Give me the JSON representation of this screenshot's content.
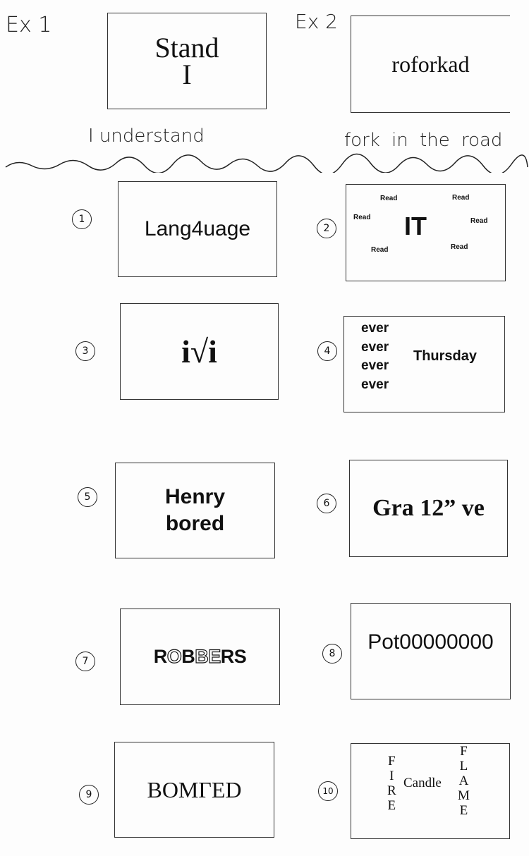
{
  "examples": [
    {
      "label": "Ex 1",
      "puzzle": [
        "Stand",
        "I"
      ],
      "answer": "I understand"
    },
    {
      "label": "Ex 2",
      "puzzle": [
        "roforkad"
      ],
      "answer": "fork in the road"
    }
  ],
  "puzzles": [
    {
      "number": "1",
      "text": "Lang4uage"
    },
    {
      "number": "2",
      "center": "IT",
      "around": [
        "Read",
        "Read",
        "Read",
        "Read",
        "Read",
        "Read"
      ]
    },
    {
      "number": "3",
      "text": "i√i"
    },
    {
      "number": "4",
      "repeated": [
        "ever",
        "ever",
        "ever",
        "ever"
      ],
      "side": "Thursday"
    },
    {
      "number": "5",
      "lines": [
        "Henry",
        "bored"
      ]
    },
    {
      "number": "6",
      "text": "Gra 12” ve"
    },
    {
      "number": "7",
      "solid1": "RO",
      "outline1": "O",
      "mid": "BB",
      "outline2": "BE",
      "end": "RS",
      "full": "ROBBERS"
    },
    {
      "number": "8",
      "text": "Pot00000000"
    },
    {
      "number": "9",
      "text": "BOMΓED"
    },
    {
      "number": "10",
      "left": [
        "F",
        "I",
        "R",
        "E"
      ],
      "center": "Candle",
      "right": [
        "F",
        "L",
        "A",
        "M",
        "E"
      ]
    }
  ]
}
